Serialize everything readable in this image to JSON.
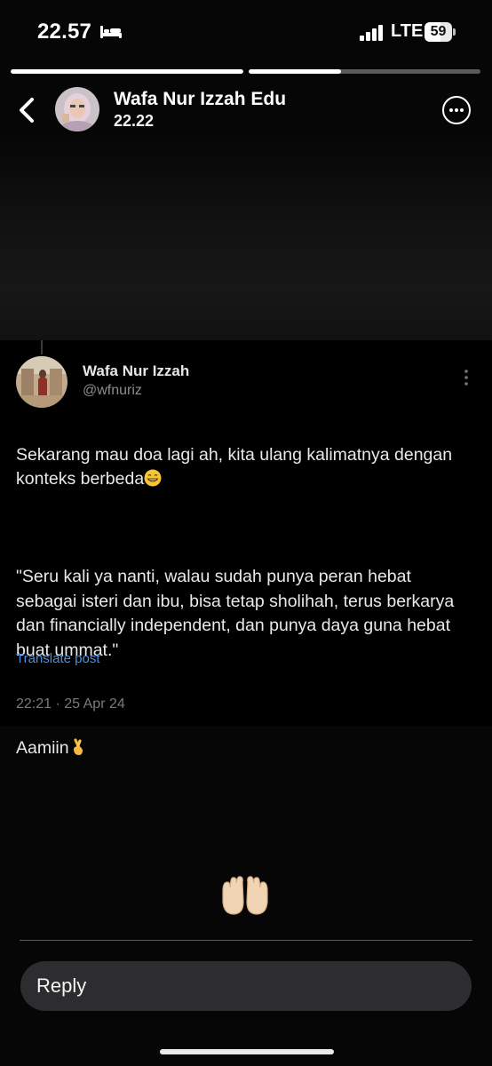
{
  "status_bar": {
    "time": "22.57",
    "network": "LTE",
    "battery_level": "59",
    "battery_fraction": 0.59,
    "icons": [
      "bed-icon",
      "signal-icon",
      "battery-icon"
    ]
  },
  "story": {
    "progress": [
      1.0,
      0.4
    ],
    "author": "Wafa Nur Izzah Edu",
    "timestamp": "22.22",
    "icons": [
      "back-arrow-icon",
      "more-options-icon"
    ]
  },
  "tweet": {
    "display_name": "Wafa Nur Izzah",
    "handle": "@wfnuriz",
    "paragraph_1": "Sekarang mau doa lagi ah, kita ulang kalimatnya dengan konteks berbeda",
    "paragraph_2": "\"Seru kali ya nanti, walau sudah punya peran hebat sebagai isteri dan ibu, bisa tetap sholihah, terus berkarya dan financially independent, dan punya daya guna hebat buat ummat.\"",
    "paragraph_3": "Aamiin",
    "emojis": [
      "grinning-face-emoji",
      "crossed-fingers-emoji"
    ],
    "translate_label": "Translate post",
    "date": "22:21 · 25 Apr 24"
  },
  "reaction": {
    "icon": "palms-up-together-emoji"
  },
  "reply": {
    "placeholder": "Reply"
  },
  "colors": {
    "background": "#060606",
    "link": "#4c8fd6",
    "muted": "#777b7f",
    "reply_bg": "#2d2d2f"
  }
}
